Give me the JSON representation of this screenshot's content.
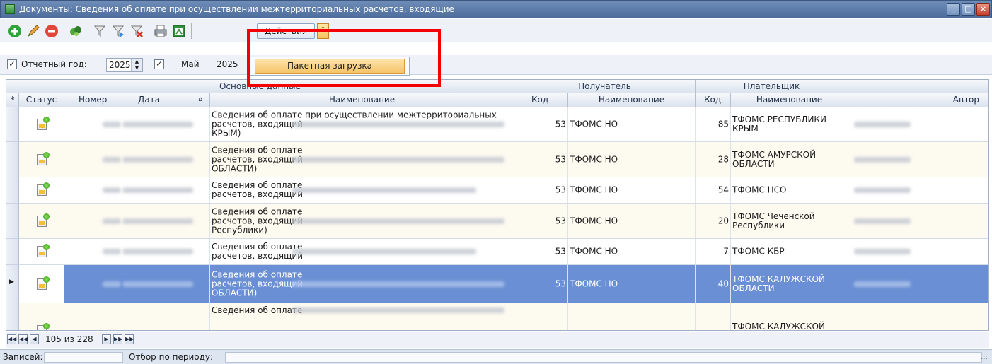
{
  "window": {
    "title": "Документы: Сведения об оплате при осуществлении межтерриториальных расчетов, входящие"
  },
  "toolbar": {
    "actions_label": "Действия",
    "dropdown_glyph": "˅"
  },
  "menu": {
    "items": [
      "Пакетная загрузка"
    ]
  },
  "filter": {
    "year_label": "Отчетный год:",
    "year_value": "2025",
    "month_value": "Май",
    "month_year": "2025"
  },
  "grid": {
    "bands": {
      "main": "Основные данные",
      "recipient": "Получатель",
      "payer": "Плательщик"
    },
    "columns": {
      "status": "Статус",
      "number": "Номер",
      "date": "Дата",
      "name": "Наименование",
      "recipient_code": "Код",
      "recipient_name": "Наименование",
      "payer_code": "Код",
      "payer_name": "Наименование",
      "author": "Автор"
    },
    "rows": [
      {
        "name1": "Сведения об оплате при осуществлении межтерриториальных",
        "name2": "расчетов, входящий",
        "name3": "КРЫМ)",
        "rcode": "53",
        "rname": "ТФОМС НО",
        "pcode": "85",
        "pname": "ТФОМС РЕСПУБЛИКИ КРЫМ"
      },
      {
        "name1": "Сведения об оплате",
        "name2": "расчетов, входящий",
        "name3": "ОБЛАСТИ)",
        "rcode": "53",
        "rname": "ТФОМС НО",
        "pcode": "28",
        "pname": "ТФОМС АМУРСКОЙ ОБЛАСТИ"
      },
      {
        "name1": "Сведения об оплате",
        "name2": "расчетов, входящий",
        "name3": "",
        "rcode": "53",
        "rname": "ТФОМС НО",
        "pcode": "54",
        "pname": "ТФОМС НСО"
      },
      {
        "name1": "Сведения об оплате",
        "name2": "расчетов, входящий",
        "name3": "Республики)",
        "rcode": "53",
        "rname": "ТФОМС НО",
        "pcode": "20",
        "pname": "ТФОМС Чеченской Республики"
      },
      {
        "name1": "Сведения об оплате",
        "name2": "расчетов, входящий",
        "name3": "",
        "rcode": "53",
        "rname": "ТФОМС НО",
        "pcode": "7",
        "pname": "ТФОМС КБР"
      },
      {
        "name1": "Сведения об оплате",
        "name2": "расчетов, входящий",
        "name3": "ОБЛАСТИ)",
        "rcode": "53",
        "rname": "ТФОМС НО",
        "pcode": "40",
        "pname": "ТФОМС КАЛУЖСКОЙ ОБЛАСТИ"
      },
      {
        "name1": "Сведения об оплате",
        "name2": "",
        "name3": "",
        "rcode": "",
        "rname": "",
        "pcode": "",
        "pname": "ТФОМС КАЛУЖСКОЙ"
      }
    ]
  },
  "pager": {
    "text": "105 из 228"
  },
  "status": {
    "records_label": "Записей:",
    "period_label": "Отбор по периоду:"
  },
  "colors": {
    "selection": "#6a8fd4",
    "highlight": "#f40000",
    "alt_row": "#fdfaf0"
  },
  "icons": [
    "app-icon",
    "add-icon",
    "edit-icon",
    "delete-icon",
    "refresh-icon",
    "filter-icon",
    "filter-apply-icon",
    "filter-clear-icon",
    "print-icon",
    "export-excel-icon",
    "document-icon",
    "checkbox-icon",
    "spinner-icon"
  ]
}
